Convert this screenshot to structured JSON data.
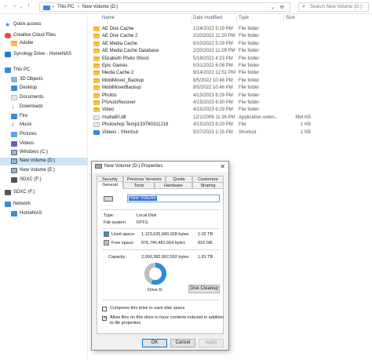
{
  "address": {
    "path": [
      "This PC",
      "New Volume (D:)"
    ],
    "search_placeholder": "Search New Volume (D:)"
  },
  "columns": {
    "name": "Name",
    "date": "Date modified",
    "type": "Type",
    "size": "Size"
  },
  "sidebar": {
    "items": [
      {
        "label": "Quick access",
        "icon": "star-icon"
      },
      {
        "label": "Creative Cloud Files",
        "icon": "cloud-icon"
      },
      {
        "label": "Adobe",
        "icon": "folder-icon"
      },
      {
        "label": "Synology Drive - HomeNAS",
        "icon": "drive-icon"
      },
      {
        "label": "This PC",
        "icon": "pc-icon"
      },
      {
        "label": "3D Objects",
        "icon": "cube-icon"
      },
      {
        "label": "Desktop",
        "icon": "desktop-icon"
      },
      {
        "label": "Documents",
        "icon": "documents-icon"
      },
      {
        "label": "Downloads",
        "icon": "download-icon"
      },
      {
        "label": "Fire",
        "icon": "folder-icon"
      },
      {
        "label": "Music",
        "icon": "music-icon"
      },
      {
        "label": "Pictures",
        "icon": "pictures-icon"
      },
      {
        "label": "Videos",
        "icon": "video-icon"
      },
      {
        "label": "Windows (C:)",
        "icon": "drive-icon"
      },
      {
        "label": "New Volume (D:)",
        "icon": "drive-icon"
      },
      {
        "label": "New Volume (E:)",
        "icon": "drive-icon"
      },
      {
        "label": "SDXC (F:)",
        "icon": "sd-icon"
      },
      {
        "label": "SDXC (F:)",
        "icon": "sd-icon"
      },
      {
        "label": "Network",
        "icon": "network-icon"
      },
      {
        "label": "HomeNAS",
        "icon": "nas-icon"
      }
    ]
  },
  "files": [
    {
      "name": "AE Disk Cache",
      "date": "1/24/2022 5:19 PM",
      "type": "File folder",
      "size": "",
      "icon": "folder-icon"
    },
    {
      "name": "AE Disk Cache 2",
      "date": "2/20/2022 11:20 PM",
      "type": "File folder",
      "size": "",
      "icon": "folder-icon"
    },
    {
      "name": "AE Media Cache",
      "date": "6/10/2022 5:29 PM",
      "type": "File folder",
      "size": "",
      "icon": "folder-icon"
    },
    {
      "name": "AE Media Cache Database",
      "date": "2/20/2022 11:09 PM",
      "type": "File folder",
      "size": "",
      "icon": "folder-icon"
    },
    {
      "name": "Elizabeth Photo Shoot",
      "date": "5/19/2021 4:23 PM",
      "type": "File folder",
      "size": "",
      "icon": "folder-icon"
    },
    {
      "name": "Epic Games",
      "date": "5/31/2022 6:08 PM",
      "type": "File folder",
      "size": "",
      "icon": "folder-icon"
    },
    {
      "name": "Media Cache 2",
      "date": "9/14/2022 12:51 PM",
      "type": "File folder",
      "size": "",
      "icon": "folder-icon"
    },
    {
      "name": "MobiMover_Backup",
      "date": "8/5/2022 10:46 PM",
      "type": "File folder",
      "size": "",
      "icon": "folder-icon"
    },
    {
      "name": "MobiMoverBackup",
      "date": "8/5/2022 10:46 PM",
      "type": "File folder",
      "size": "",
      "icon": "folder-icon"
    },
    {
      "name": "Photos",
      "date": "4/15/2023 6:29 PM",
      "type": "File folder",
      "size": "",
      "icon": "folder-icon"
    },
    {
      "name": "PSAutoRecover",
      "date": "4/15/2023 6:30 PM",
      "type": "File folder",
      "size": "",
      "icon": "folder-icon"
    },
    {
      "name": "Video",
      "date": "4/15/2023 6:29 PM",
      "type": "File folder",
      "size": "",
      "icon": "folder-icon"
    },
    {
      "name": "msdia80.dll",
      "date": "12/1/2006 11:36 PM",
      "type": "Application exten...",
      "size": "884 KB",
      "icon": "dll-file-icon"
    },
    {
      "name": "Photoshop Temp133760311216",
      "date": "4/15/2023 6:20 PM",
      "type": "File",
      "size": "1 KB",
      "icon": "file-icon"
    },
    {
      "name": "Videos - Shortcut",
      "date": "5/27/2023 1:15 PM",
      "type": "Shortcut",
      "size": "1 KB",
      "icon": "shortcut-icon"
    }
  ],
  "dialog": {
    "title": "New Volume (D:) Properties",
    "tabs_row1": [
      "Security",
      "Previous Versions",
      "Quota",
      "Customize"
    ],
    "tabs_row2": [
      "General",
      "Tools",
      "Hardware",
      "Sharing"
    ],
    "active_tab": "General",
    "volume_name": "New Volume",
    "type_label": "Type:",
    "type_value": "Local Disk",
    "fs_label": "File system:",
    "fs_value": "NTFS",
    "used_label": "Used space:",
    "used_bytes": "1,123,635,580,928 bytes",
    "used_size": "1.02 TB",
    "free_label": "Free space:",
    "free_bytes": "876,746,481,664 bytes",
    "free_size": "816 GB",
    "cap_label": "Capacity:",
    "cap_bytes": "2,000,382,062,592 bytes",
    "cap_size": "1.81 TB",
    "used_fraction": 0.5617,
    "drive_label": "Drive D:",
    "cleanup_label": "Disk Cleanup",
    "compress_label": "Compress this drive to save disk space",
    "index_label": "Allow files on this drive to have contents indexed in addition to file properties",
    "ok_label": "OK",
    "cancel_label": "Cancel",
    "apply_label": "Apply",
    "colors": {
      "used": "#2b8fd6",
      "free": "#bdbdbd"
    }
  }
}
